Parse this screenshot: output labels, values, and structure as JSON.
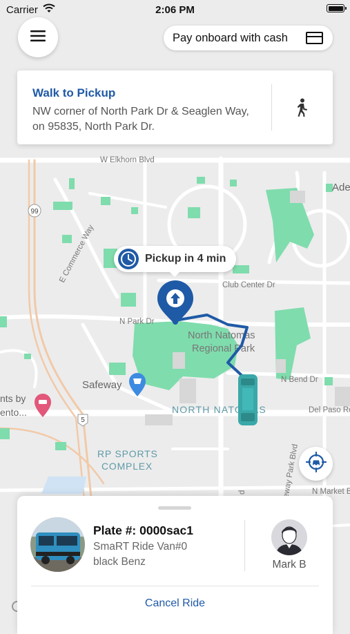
{
  "status_bar": {
    "carrier": "Carrier",
    "time": "2:06 PM"
  },
  "header": {
    "pay_label": "Pay onboard with cash"
  },
  "walk_card": {
    "title": "Walk to Pickup",
    "address": "NW corner of North Park Dr & Seaglen Way, on 95835, North Park Dr."
  },
  "pickup": {
    "label": "Pickup in 4 min"
  },
  "map": {
    "labels": {
      "w_elkhorn": "W Elkhorn Blvd",
      "e_commerce": "E Commerce Way",
      "club_center": "Club Center Dr",
      "n_park": "N Park Dr",
      "park_line1": "North Natomas",
      "park_line2": "Regional Park",
      "safeway": "Safeway",
      "n_bend": "N Bend Dr",
      "north_natomas": "NORTH NATOMAS",
      "del_paso": "Del Paso Ro",
      "rp_line1": "RP SPORTS",
      "rp_line2": "COMPLEX",
      "gateway": "Gateway Park Blvd",
      "n_market": "N Market B",
      "ade": "Ade",
      "hotel_line1": "nts by",
      "hotel_line2": "ento...",
      "hwy99": "99",
      "hwy5": "5",
      "road_d": "d"
    },
    "colors": {
      "background": "#ececec",
      "park": "#7fdcad",
      "route": "#1f5aa6",
      "van": "#3aa8a8"
    }
  },
  "ride": {
    "plate": "Plate #: 0000sac1",
    "vehicle_name": "SmaRT Ride Van#0",
    "vehicle_desc": "black Benz",
    "driver_name": "Mark B",
    "cancel_label": "Cancel Ride"
  }
}
